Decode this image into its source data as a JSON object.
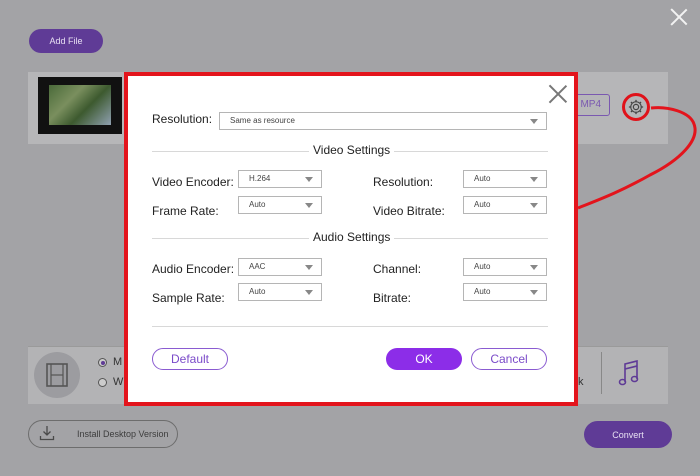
{
  "app": {
    "add_file_label": "Add File",
    "format_badge": "MP4",
    "install_label": "Install Desktop Version",
    "convert_label": "Convert",
    "radio_1_partial": "M",
    "radio_2_partial": "W",
    "right_partial": "k"
  },
  "dialog": {
    "resolution_label": "Resolution:",
    "resolution_value": "Same as resource",
    "video_section_title": "Video Settings",
    "video_encoder_label": "Video Encoder:",
    "video_encoder_value": "H.264",
    "video_resolution_label": "Resolution:",
    "video_resolution_value": "Auto",
    "frame_rate_label": "Frame Rate:",
    "frame_rate_value": "Auto",
    "video_bitrate_label": "Video Bitrate:",
    "video_bitrate_value": "Auto",
    "audio_section_title": "Audio Settings",
    "audio_encoder_label": "Audio Encoder:",
    "audio_encoder_value": "AAC",
    "channel_label": "Channel:",
    "channel_value": "Auto",
    "sample_rate_label": "Sample Rate:",
    "sample_rate_value": "Auto",
    "bitrate_label": "Bitrate:",
    "bitrate_value": "Auto",
    "default_label": "Default",
    "ok_label": "OK",
    "cancel_label": "Cancel"
  },
  "colors": {
    "accent": "#8c2de8",
    "highlight": "#e3141c"
  }
}
